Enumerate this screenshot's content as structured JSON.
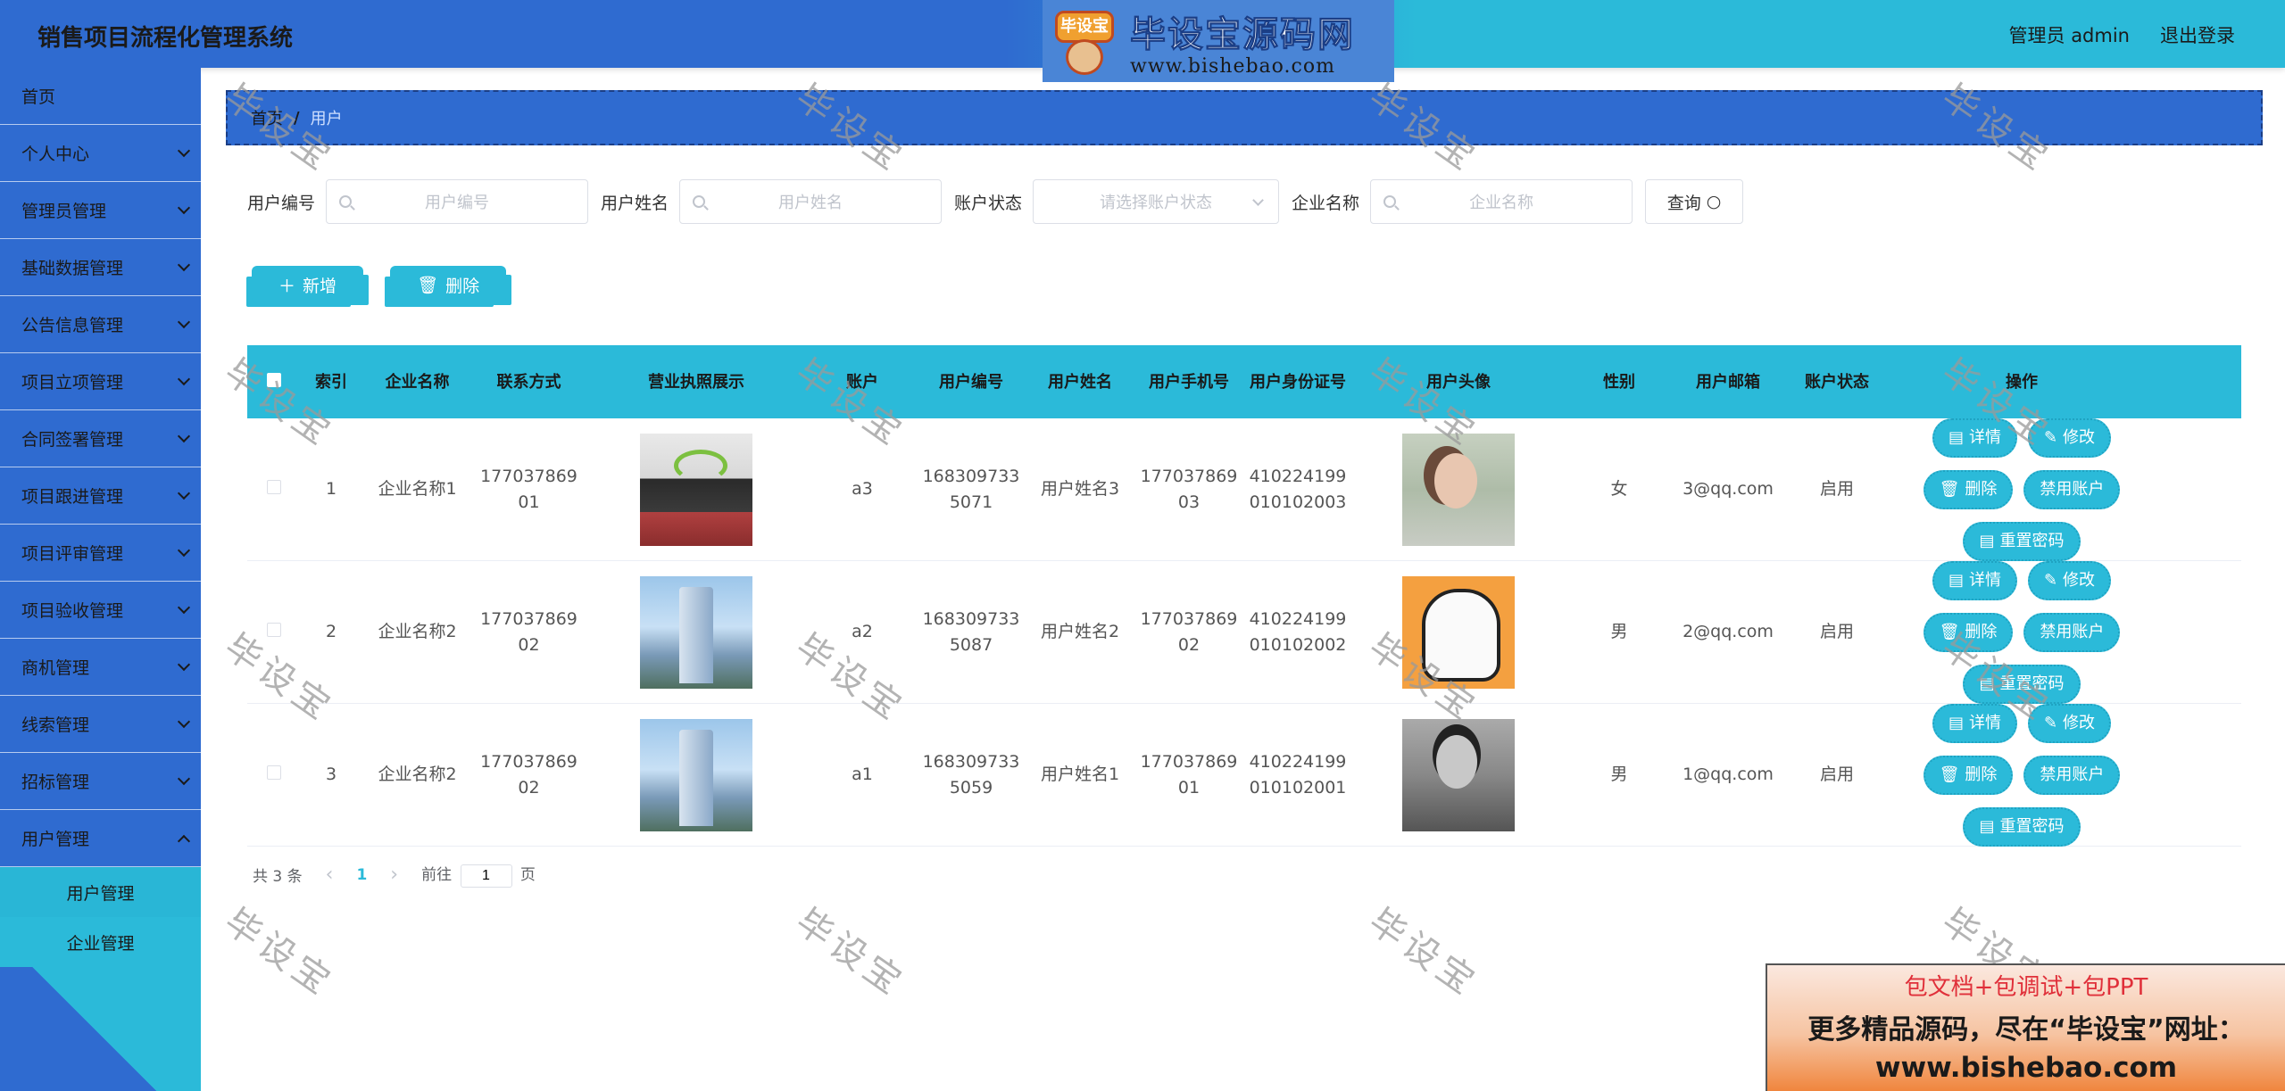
{
  "header": {
    "app_title": "销售项目流程化管理系统",
    "admin_label": "管理员 admin",
    "logout_label": "退出登录",
    "logo_badge": "毕设宝",
    "logo_title": "毕设宝源码网",
    "logo_url": "www.bishebao.com"
  },
  "sidebar": {
    "items": [
      {
        "label": "首页",
        "has_arrow": false
      },
      {
        "label": "个人中心",
        "has_arrow": true
      },
      {
        "label": "管理员管理",
        "has_arrow": true
      },
      {
        "label": "基础数据管理",
        "has_arrow": true
      },
      {
        "label": "公告信息管理",
        "has_arrow": true
      },
      {
        "label": "项目立项管理",
        "has_arrow": true
      },
      {
        "label": "合同签署管理",
        "has_arrow": true
      },
      {
        "label": "项目跟进管理",
        "has_arrow": true
      },
      {
        "label": "项目评审管理",
        "has_arrow": true
      },
      {
        "label": "项目验收管理",
        "has_arrow": true
      },
      {
        "label": "商机管理",
        "has_arrow": true
      },
      {
        "label": "线索管理",
        "has_arrow": true
      },
      {
        "label": "招标管理",
        "has_arrow": true
      },
      {
        "label": "用户管理",
        "has_arrow": true
      }
    ],
    "sub_items": [
      "用户管理",
      "企业管理"
    ]
  },
  "breadcrumb": {
    "home": "首页",
    "separator": "/",
    "current": "用户"
  },
  "search": {
    "user_no_label": "用户编号",
    "user_no_placeholder": "用户编号",
    "user_name_label": "用户姓名",
    "user_name_placeholder": "用户姓名",
    "status_label": "账户状态",
    "status_placeholder": "请选择账户状态",
    "company_label": "企业名称",
    "company_placeholder": "企业名称",
    "query_label": "查询"
  },
  "actions": {
    "add_label": "新增",
    "delete_label": "删除"
  },
  "table": {
    "headers": [
      "索引",
      "企业名称",
      "联系方式",
      "营业执照展示",
      "账户",
      "用户编号",
      "用户姓名",
      "用户手机号",
      "用户身份证号",
      "用户头像",
      "性别",
      "用户邮箱",
      "账户状态",
      "操作"
    ],
    "rows": [
      {
        "index": "1",
        "company": "企业名称1",
        "phone_a": "177037869",
        "phone_b": "01",
        "account": "a3",
        "no_a": "168309733",
        "no_b": "5071",
        "name": "用户姓名3",
        "mobile_a": "177037869",
        "mobile_b": "03",
        "id_a": "410224199",
        "id_b": "010102003",
        "gender": "女",
        "email": "3@qq.com",
        "status": "启用"
      },
      {
        "index": "2",
        "company": "企业名称2",
        "phone_a": "177037869",
        "phone_b": "02",
        "account": "a2",
        "no_a": "168309733",
        "no_b": "5087",
        "name": "用户姓名2",
        "mobile_a": "177037869",
        "mobile_b": "02",
        "id_a": "410224199",
        "id_b": "010102002",
        "gender": "男",
        "email": "2@qq.com",
        "status": "启用"
      },
      {
        "index": "3",
        "company": "企业名称2",
        "phone_a": "177037869",
        "phone_b": "02",
        "account": "a1",
        "no_a": "168309733",
        "no_b": "5059",
        "name": "用户姓名1",
        "mobile_a": "177037869",
        "mobile_b": "01",
        "id_a": "410224199",
        "id_b": "010102001",
        "gender": "男",
        "email": "1@qq.com",
        "status": "启用"
      }
    ],
    "ops": {
      "detail": "详情",
      "edit": "修改",
      "delete": "删除",
      "disable": "禁用账户",
      "reset": "重置密码"
    }
  },
  "pager": {
    "total": "共 3 条",
    "page": "1",
    "goto_prefix": "前往",
    "goto_value": "1",
    "goto_suffix": "页"
  },
  "watermark": "毕设宝",
  "promo": {
    "line1": "包文档+包调试+包PPT",
    "line2": "更多精品源码，尽在“毕设宝”网址：",
    "line3": "www.bishebao.com"
  },
  "colors": {
    "blue": "#2f6bd0",
    "cyan": "#2bbad9"
  }
}
